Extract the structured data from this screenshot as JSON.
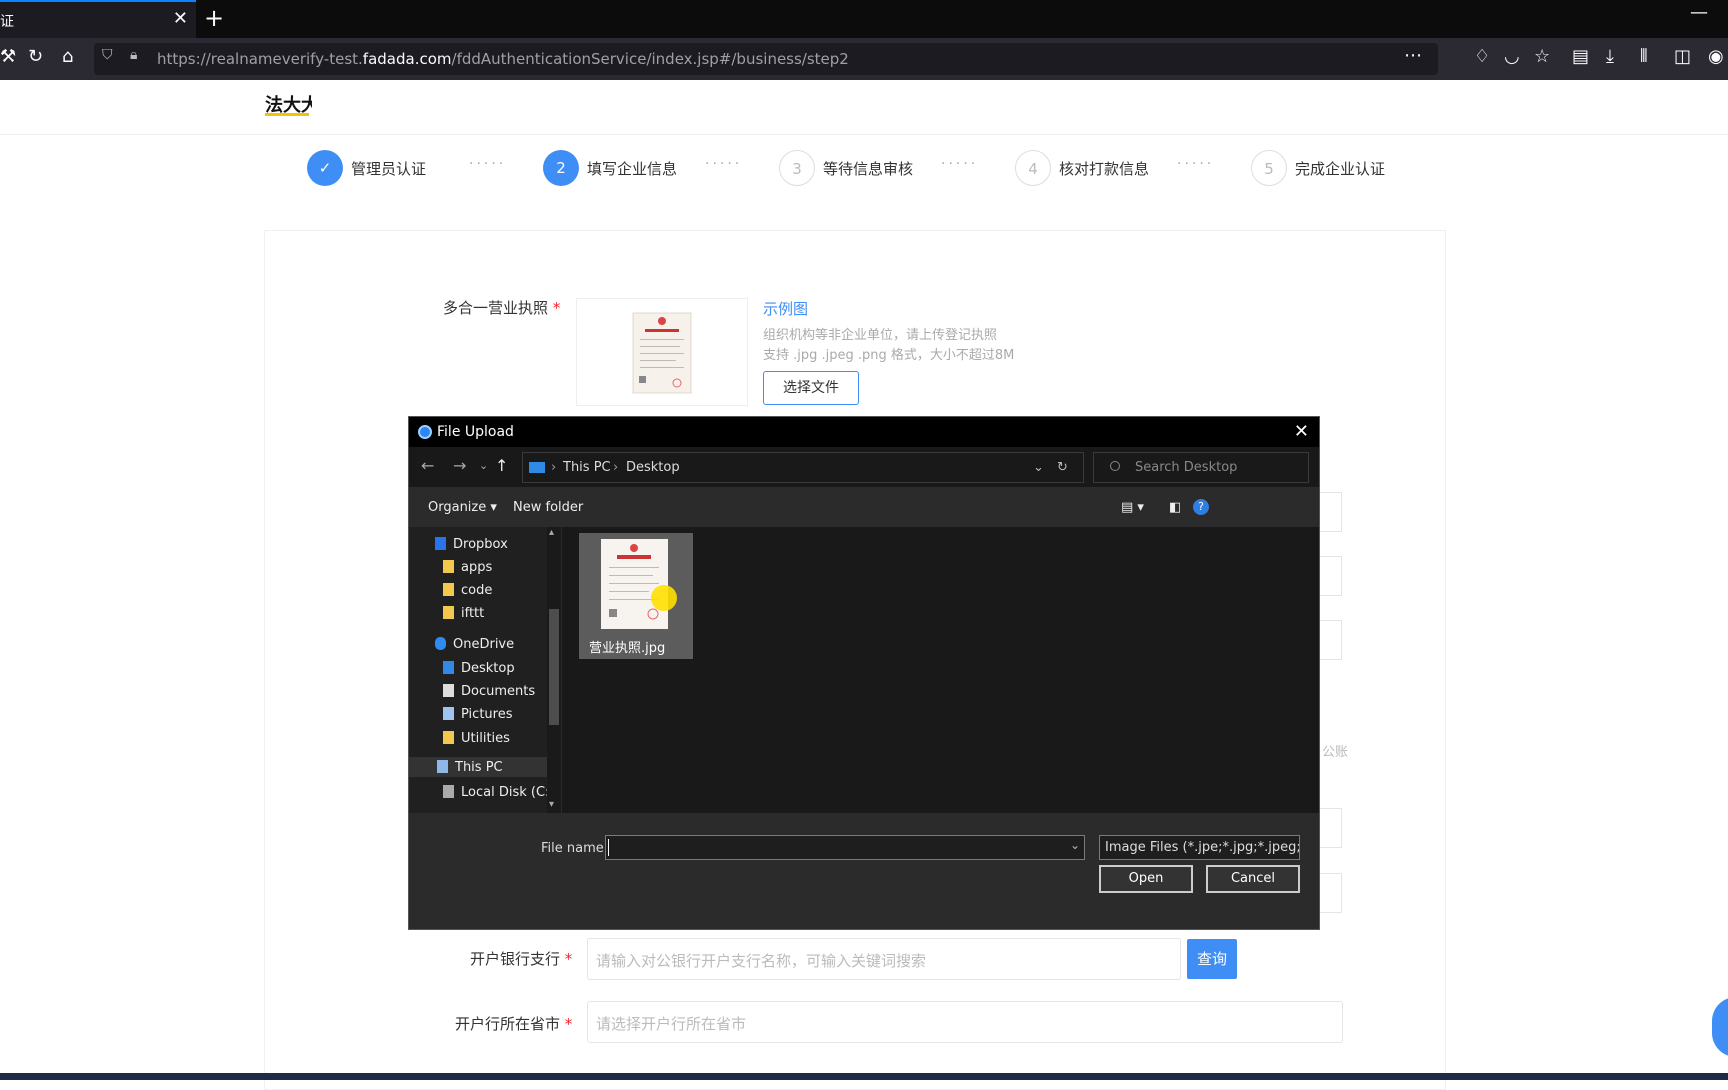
{
  "browser": {
    "tab_title": "证",
    "url_prefix": "https://realnameverify-test.",
    "url_domain": "fadada.com",
    "url_path": "/fddAuthenticationService/index.jsp#/business/step2"
  },
  "site": {
    "logo_text": "法大大"
  },
  "steps": [
    {
      "num": "✓",
      "label": "管理员认证",
      "state": "done"
    },
    {
      "num": "2",
      "label": "填写企业信息",
      "state": "active"
    },
    {
      "num": "3",
      "label": "等待信息审核",
      "state": "todo"
    },
    {
      "num": "4",
      "label": "核对打款信息",
      "state": "todo"
    },
    {
      "num": "5",
      "label": "完成企业认证",
      "state": "todo"
    }
  ],
  "step_dots": "·····",
  "form": {
    "license_label": "多合一营业执照",
    "required_mark": "*",
    "sample_link": "示例图",
    "hint1": "组织机构等非企业单位，请上传登记执照",
    "hint2": "支持 .jpg .jpeg .png 格式，大小不超过8M",
    "choose_file": "选择文件",
    "partial_text": "公账",
    "branch_label": "开户银行支行",
    "branch_placeholder": "请输入对公银行开户支行名称，可输入关键词搜索",
    "query_button": "查询",
    "city_label": "开户行所在省市",
    "city_placeholder": "请选择开户行所在省市"
  },
  "dialog": {
    "title": "File Upload",
    "breadcrumb": [
      "This PC",
      "Desktop"
    ],
    "search_placeholder": "Search Desktop",
    "organize": "Organize",
    "new_folder": "New folder",
    "help": "?",
    "nav_items": [
      {
        "label": "Dropbox",
        "icon": "dropbox-icon"
      },
      {
        "label": "apps",
        "icon": "folder-icon"
      },
      {
        "label": "code",
        "icon": "folder-icon"
      },
      {
        "label": "ifttt",
        "icon": "folder-icon"
      },
      {
        "label": "OneDrive",
        "icon": "onedrive-icon"
      },
      {
        "label": "Desktop",
        "icon": "desktop-icon"
      },
      {
        "label": "Documents",
        "icon": "documents-icon"
      },
      {
        "label": "Pictures",
        "icon": "pictures-icon"
      },
      {
        "label": "Utilities",
        "icon": "folder-icon"
      },
      {
        "label": "This PC",
        "icon": "pc-icon"
      },
      {
        "label": "Local Disk (C:)",
        "icon": "disk-icon"
      }
    ],
    "file": {
      "name": "营业执照.jpg"
    },
    "file_name_label": "File name:",
    "file_name_value": "",
    "file_type": "Image Files (*.jpe;*.jpg;*.jpeg;*.g",
    "open": "Open",
    "cancel": "Cancel"
  },
  "colors": {
    "accent": "#3f8ef5",
    "dialog_bg": "#2b2b2b",
    "tab_indicator": "#0a84ff"
  }
}
